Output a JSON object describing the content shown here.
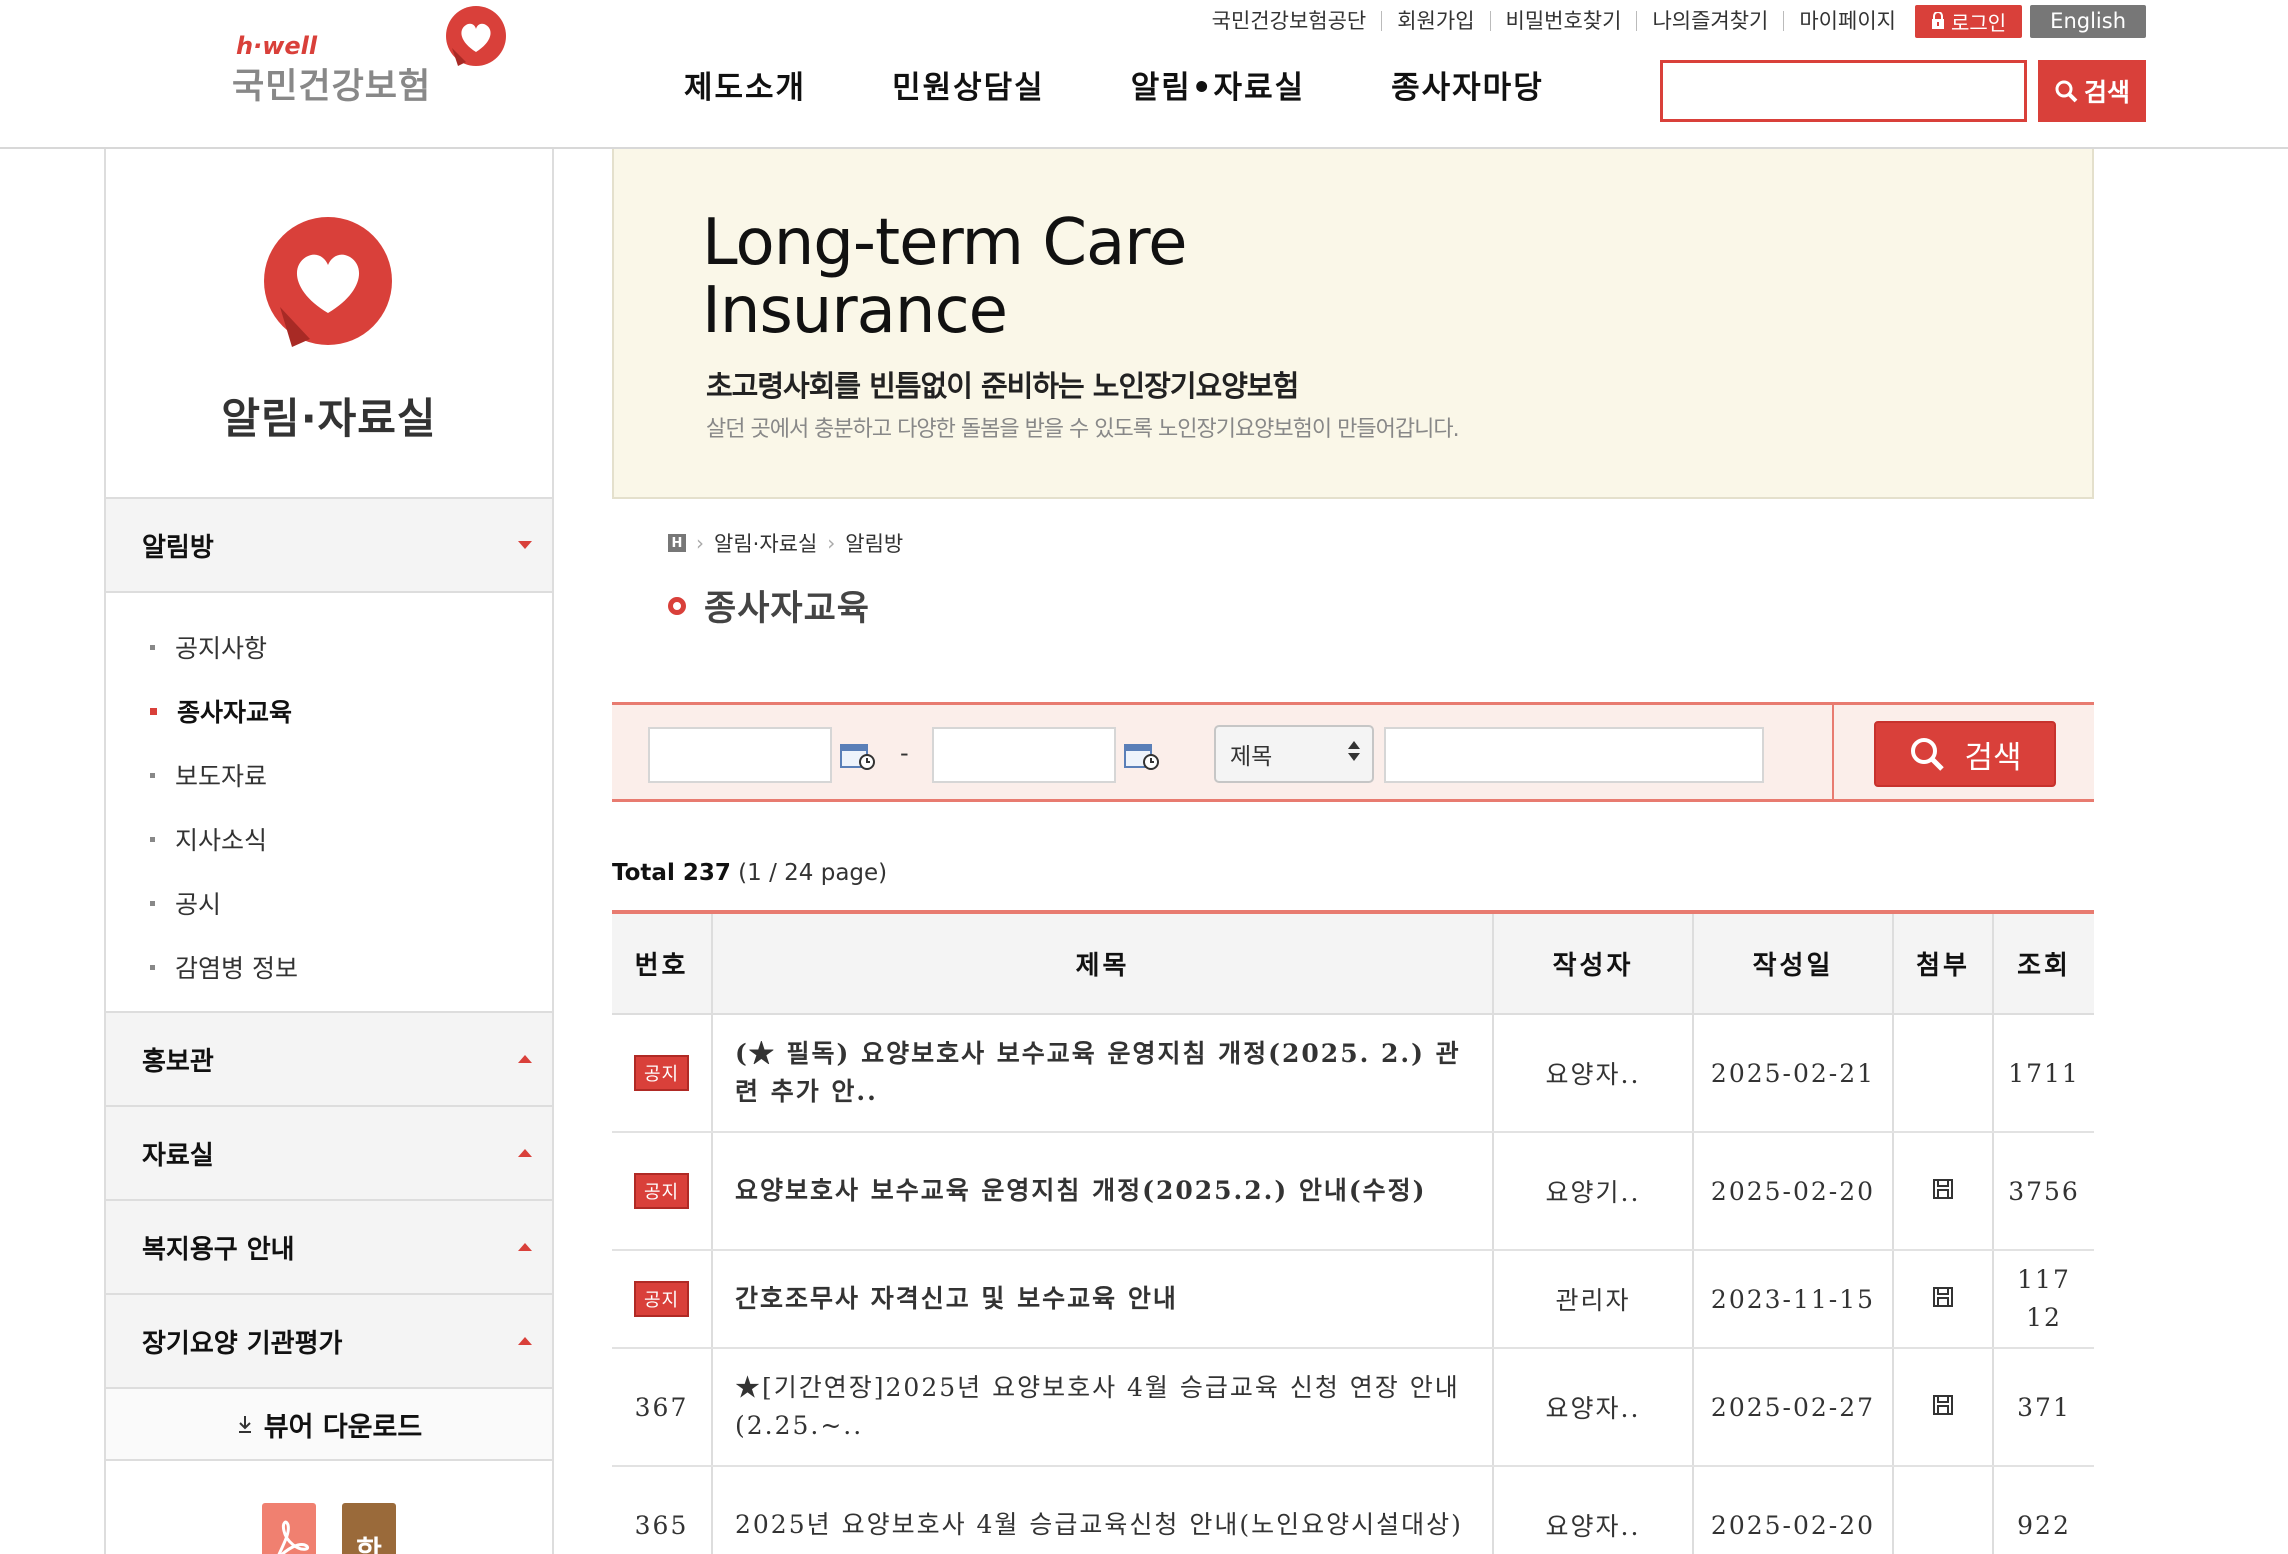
{
  "header": {
    "logo_sub": "h·well",
    "logo_main": "국민건강보험",
    "util_links": [
      "국민건강보험공단",
      "회원가입",
      "비밀번호찾기",
      "나의즐겨찾기",
      "마이페이지"
    ],
    "login_label": "로그인",
    "english_label": "English",
    "gnb": [
      "제도소개",
      "민원상담실",
      "알림•자료실",
      "종사자마당"
    ],
    "search_button": "검색",
    "search_value": ""
  },
  "sidebar": {
    "title": "알림·자료실",
    "menu_notice": "알림방",
    "sub_items": [
      "공지사항",
      "종사자교육",
      "보도자료",
      "지사소식",
      "공시",
      "감염병 정보"
    ],
    "active_index": 1,
    "menu_promo": "홍보관",
    "menu_data": "자료실",
    "menu_welfare": "복지용구 안내",
    "menu_eval": "장기요양 기관평가",
    "download_label": "뷰어 다운로드",
    "hwp_label": "한"
  },
  "banner": {
    "title_line1": "Long-term Care",
    "title_line2": "Insurance",
    "sub1": "초고령사회를 빈틈없이 준비하는 노인장기요양보험",
    "sub2": "살던 곳에서 충분하고 다양한 돌봄을 받을 수 있도록 노인장기요양보험이 만들어갑니다."
  },
  "breadcrumb": {
    "home": "H",
    "level1": "알림·자료실",
    "level2": "알림방"
  },
  "page_title": "종사자교육",
  "search": {
    "date_from": "",
    "date_to": "",
    "dash": "-",
    "select_value": "제목",
    "keyword": "",
    "button_label": "검색"
  },
  "total": {
    "label": "Total 237",
    "page_info": "(1 / 24 page)"
  },
  "table": {
    "headers": [
      "번호",
      "제목",
      "작성자",
      "작성일",
      "첨부",
      "조회"
    ],
    "notice_label": "공지",
    "rows": [
      {
        "no": "",
        "notice": true,
        "title": "(★ 필독) 요양보호사 보수교육 운영지침 개정(2025. 2.) 관련 추가 안..",
        "author": "요양자..",
        "date": "2025-02-21",
        "attach": false,
        "views": "1711"
      },
      {
        "no": "",
        "notice": true,
        "title": "요양보호사 보수교육 운영지침 개정(2025.2.) 안내(수정)",
        "author": "요양기..",
        "date": "2025-02-20",
        "attach": true,
        "views": "3756"
      },
      {
        "no": "",
        "notice": true,
        "title": "간호조무사 자격신고 및 보수교육 안내",
        "author": "관리자",
        "date": "2023-11-15",
        "attach": true,
        "views": "11712"
      },
      {
        "no": "367",
        "notice": false,
        "title": "★[기간연장]2025년 요양보호사 4월 승급교육 신청 연장 안내(2.25.~..",
        "author": "요양자..",
        "date": "2025-02-27",
        "attach": true,
        "views": "371"
      },
      {
        "no": "365",
        "notice": false,
        "title": "2025년 요양보호사 4월 승급교육신청 안내(노인요양시설대상)",
        "author": "요양자..",
        "date": "2025-02-20",
        "attach": false,
        "views": "922"
      }
    ]
  },
  "colors": {
    "brand_red": "#d9403a",
    "banner_bg": "#faf7e8",
    "search_bg": "#fbeeea"
  }
}
